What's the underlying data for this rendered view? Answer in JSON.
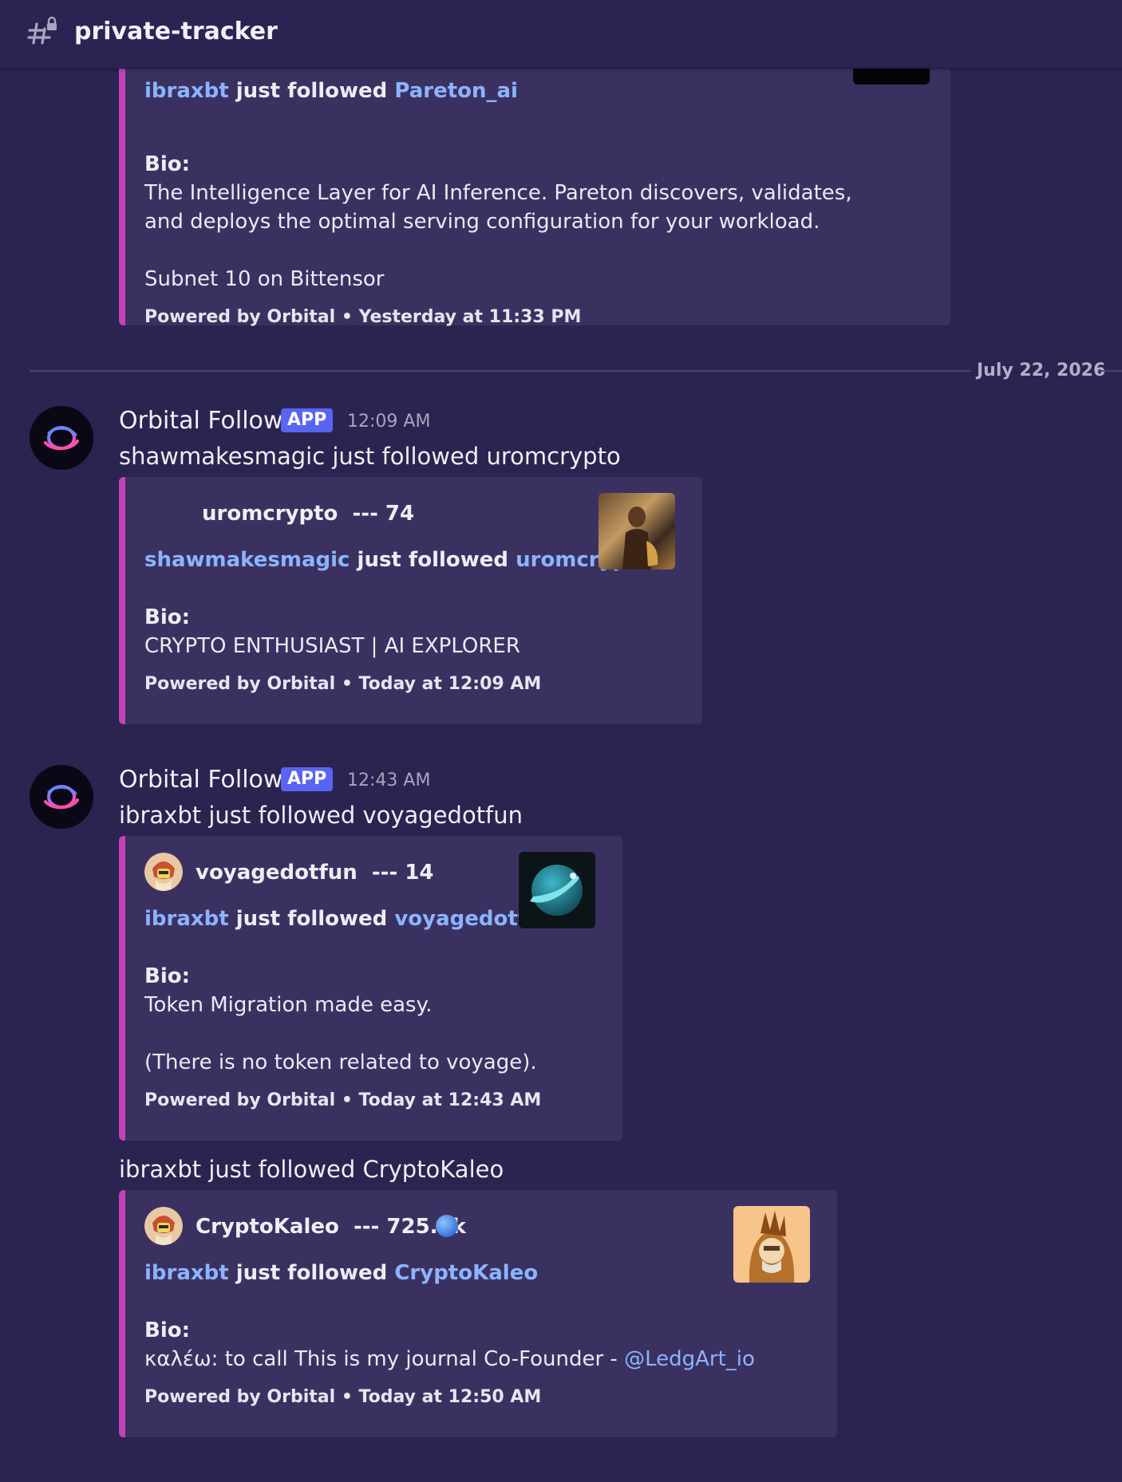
{
  "header": {
    "icon": "channel-hash-lock-icon",
    "channel_name": "private-tracker"
  },
  "colors": {
    "background": "#2b2350",
    "embed_background": "#3b3161",
    "embed_accent": "#c342b8",
    "link": "#8bb4ff",
    "app_badge": "#5865f2"
  },
  "embed0": {
    "follower": "ibraxbt",
    "action": "just followed",
    "followed": "Pareton_ai",
    "bio_label": "Bio:",
    "bio_line1": "The Intelligence Layer for AI Inference. Pareton discovers, validates,",
    "bio_line2": "and deploys the optimal serving configuration for your workload.",
    "bio_line3": "Subnet 10 on Bittensor",
    "footer": "Powered by Orbital • Yesterday at 11:33 PM"
  },
  "divider": {
    "date": "July 22, 2026"
  },
  "message1": {
    "author": "Orbital Follow",
    "badge": "APP",
    "time": "12:09 AM",
    "text": "shawmakesmagic just followed uromcrypto",
    "embed": {
      "author": "uromcrypto",
      "count": "--- 74",
      "follower": "shawmakesmagic",
      "action": "just followed",
      "followed": "uromcrypto",
      "bio_label": "Bio:",
      "bio_line1": "CRYPTO ENTHUSIAST | AI EXPLORER",
      "footer": "Powered by Orbital • Today at 12:09 AM"
    }
  },
  "message2": {
    "author": "Orbital Follow",
    "badge": "APP",
    "time": "12:43 AM",
    "text": "ibraxbt just followed voyagedotfun",
    "embed": {
      "author": "voyagedotfun",
      "count": "--- 14",
      "follower": "ibraxbt",
      "action": "just followed",
      "followed": "voyagedotfun",
      "bio_label": "Bio:",
      "bio_line1": "Token Migration made easy.",
      "bio_line2": "(There is no token related to voyage).",
      "footer": "Powered by Orbital • Today at 12:43 AM"
    }
  },
  "message3": {
    "text": "ibraxbt just followed CryptoKaleo",
    "embed": {
      "author": "CryptoKaleo",
      "count": "--- 725.9k",
      "follower": "ibraxbt",
      "action": "just followed",
      "followed": "CryptoKaleo",
      "bio_label": "Bio:",
      "bio_text": "καλέω: to call This is my journal Co-Founder - ",
      "bio_mention": "@LedgArt_io",
      "footer": "Powered by Orbital • Today at 12:50 AM"
    }
  }
}
